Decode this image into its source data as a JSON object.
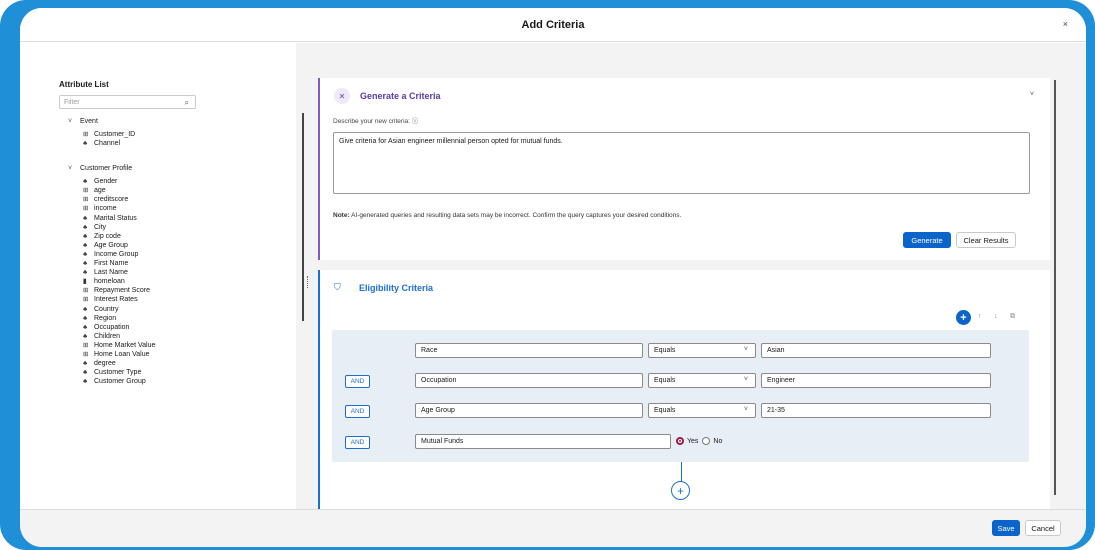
{
  "modal": {
    "title": "Add Criteria",
    "close": "×"
  },
  "attribute_list": {
    "title": "Attribute List",
    "filter_placeholder": "Filter",
    "groups": [
      {
        "label": "Event",
        "items": [
          {
            "label": "Customer_ID",
            "icon": "number-icon"
          },
          {
            "label": "Channel",
            "icon": "text-icon"
          }
        ]
      },
      {
        "label": "Customer Profile",
        "items": [
          {
            "label": "Gender",
            "icon": "text-icon"
          },
          {
            "label": "age",
            "icon": "number-icon"
          },
          {
            "label": "creditscore",
            "icon": "number-icon"
          },
          {
            "label": "income",
            "icon": "number-icon"
          },
          {
            "label": "Marital Status",
            "icon": "text-icon"
          },
          {
            "label": "City",
            "icon": "text-icon"
          },
          {
            "label": "Zip code",
            "icon": "text-icon"
          },
          {
            "label": "Age Group",
            "icon": "text-icon"
          },
          {
            "label": "Income Group",
            "icon": "text-icon"
          },
          {
            "label": "First Name",
            "icon": "text-icon"
          },
          {
            "label": "Last Name",
            "icon": "text-icon"
          },
          {
            "label": "homeloan",
            "icon": "boolean-icon"
          },
          {
            "label": "Repayment Score",
            "icon": "number-icon"
          },
          {
            "label": "Interest Rates",
            "icon": "number-icon"
          },
          {
            "label": "Country",
            "icon": "text-icon"
          },
          {
            "label": "Region",
            "icon": "text-icon"
          },
          {
            "label": "Occupation",
            "icon": "text-icon"
          },
          {
            "label": "Children",
            "icon": "text-icon"
          },
          {
            "label": "Home Market Value",
            "icon": "number-icon"
          },
          {
            "label": "Home Loan Value",
            "icon": "number-icon"
          },
          {
            "label": "degree",
            "icon": "text-icon"
          },
          {
            "label": "Customer Type",
            "icon": "text-icon"
          },
          {
            "label": "Customer Group",
            "icon": "text-icon"
          }
        ]
      }
    ]
  },
  "generate": {
    "title": "Generate a Criteria",
    "describe_label": "Describe your new criteria:",
    "prompt": "Give criteria for Asian engineer millennial person opted for mutual funds.",
    "note_label": "Note:",
    "note_text": "AI-generated queries and resulting data sets may be incorrect. Confirm the query captures your desired conditions.",
    "generate_button": "Generate",
    "clear_button": "Clear Results"
  },
  "eligibility": {
    "title": "Eligibility Criteria",
    "conditions": [
      {
        "connector": "",
        "attribute": "Race",
        "operator": "Equals",
        "value": "Asian"
      },
      {
        "connector": "AND",
        "attribute": "Occupation",
        "operator": "Equals",
        "value": "Engineer"
      },
      {
        "connector": "AND",
        "attribute": "Age Group",
        "operator": "Equals",
        "value": "21-35"
      },
      {
        "connector": "AND",
        "attribute": "Mutual Funds",
        "radio_yes": "Yes",
        "radio_no": "No",
        "selected": "Yes"
      }
    ]
  },
  "footer": {
    "save": "Save",
    "cancel": "Cancel"
  },
  "colors": {
    "frame": "#1f8fd8",
    "primary": "#0a64c9",
    "generate_accent": "#5b3aa8",
    "eligibility_accent": "#1b6fd0",
    "radio_selected": "#9c1c47"
  }
}
